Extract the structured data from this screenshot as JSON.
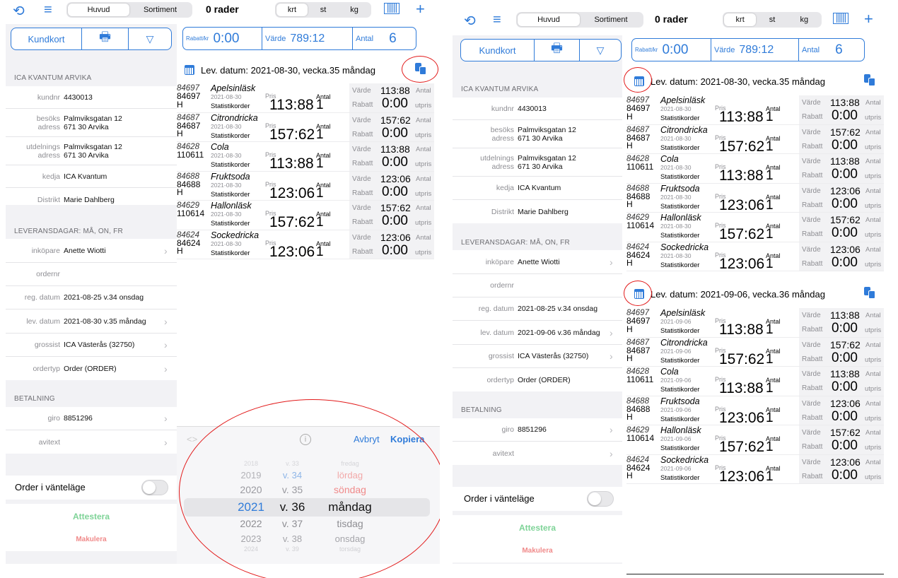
{
  "toolbar": {
    "tab_main": "Huvud",
    "tab_assort": "Sortiment",
    "rows": "0 rader",
    "unit_krt": "krt",
    "unit_st": "st",
    "unit_kg": "kg"
  },
  "kbar": {
    "kundkort": "Kundkort"
  },
  "vbar": {
    "rabatt_label": "Rabatt/kr",
    "rabatt_value": "0:00",
    "varde_label": "Värde",
    "varde_value": "789:12",
    "antal_label": "Antal",
    "antal_value": "6"
  },
  "store": {
    "name": "ICA KVANTUM ARVIKA"
  },
  "fields": {
    "kundnr_label": "kundnr",
    "kundnr": "4430013",
    "besoks_label1": "besöks",
    "besoks_label2": "adress",
    "besoks_val1": "Palmviksgatan 12",
    "besoks_val2": "671 30 Arvika",
    "utd_label1": "utdelnings",
    "utd_label2": "adress",
    "utd_val1": "Palmviksgatan 12",
    "utd_val2": "671 30 Arvika",
    "kedja_label": "kedja",
    "kedja": "ICA Kvantum",
    "distrikt_label": "Distrikt",
    "distrikt": "Marie Dahlberg"
  },
  "delivery": {
    "title": "LEVERANSDAGAR: MÅ, ON, FR"
  },
  "order": {
    "inkopare_label": "inköpare",
    "inkopare": "Anette Wiotti",
    "ordernr_label": "ordernr",
    "reg_label": "reg. datum",
    "reg": "2021-08-25 v.34  onsdag",
    "lev_label": "lev. datum",
    "lev_left": "2021-08-30 v.35  måndag",
    "lev_right": "2021-09-06 v.36  måndag",
    "grossist_label": "grossist",
    "grossist": "ICA Västerås (32750)",
    "ordertyp_label": "ordertyp",
    "ordertyp": "Order (ORDER)"
  },
  "payment": {
    "title": "BETALNING",
    "giro_label": "giro",
    "giro": "8851296",
    "avitext_label": "avitext"
  },
  "wait": {
    "label": "Order i vänteläge"
  },
  "actions": {
    "attestera": "Attestera",
    "makulera": "Makulera"
  },
  "groups": [
    {
      "header": "Lev. datum: 2021-08-30, vecka.35  måndag",
      "date": "2021-08-30"
    },
    {
      "header": "Lev. datum: 2021-09-06, vecka.36  måndag",
      "date": "2021-09-06"
    }
  ],
  "item_labels": {
    "statistik": "Statistikorder",
    "pris": "Pris",
    "antal": "Antal",
    "varde": "Värde",
    "rabatt": "Rabatt",
    "side_antal": "Antal",
    "side_utpris": "utpris"
  },
  "items": [
    {
      "code": "84697",
      "name": "Apelsinläsk",
      "ean1": "84697",
      "ean2": "H",
      "pris": "113:88",
      "antal": "1",
      "varde": "113:88",
      "rabatt": "0:00"
    },
    {
      "code": "84687",
      "name": "Citrondricka",
      "ean1": "84687",
      "ean2": "H",
      "pris": "157:62",
      "antal": "1",
      "varde": "157:62",
      "rabatt": "0:00"
    },
    {
      "code": "84628",
      "name": "Cola",
      "ean1": "110611",
      "ean2": "",
      "pris": "113:88",
      "antal": "1",
      "varde": "113:88",
      "rabatt": "0:00"
    },
    {
      "code": "84688",
      "name": "Fruktsoda",
      "ean1": "84688",
      "ean2": "H",
      "pris": "123:06",
      "antal": "1",
      "varde": "123:06",
      "rabatt": "0:00"
    },
    {
      "code": "84629",
      "name": "Hallonläsk",
      "ean1": "110614",
      "ean2": "",
      "pris": "157:62",
      "antal": "1",
      "varde": "157:62",
      "rabatt": "0:00"
    },
    {
      "code": "84624",
      "name": "Sockedricka",
      "ean1": "84624",
      "ean2": "H",
      "pris": "123:06",
      "antal": "1",
      "varde": "123:06",
      "rabatt": "0:00"
    }
  ],
  "picker": {
    "cancel": "Avbryt",
    "copy": "Kopiera",
    "rows": [
      {
        "year": "2018",
        "week": "v. 33",
        "day": "fredag"
      },
      {
        "year": "2019",
        "week": "v. 34",
        "day": "lördag"
      },
      {
        "year": "2020",
        "week": "v. 35",
        "day": "söndag"
      },
      {
        "year": "2021",
        "week": "v. 36",
        "day": "måndag"
      },
      {
        "year": "2022",
        "week": "v. 37",
        "day": "tisdag"
      },
      {
        "year": "2023",
        "week": "v. 38",
        "day": "onsdag"
      },
      {
        "year": "2024",
        "week": "v. 39",
        "day": "torsdag"
      }
    ]
  }
}
